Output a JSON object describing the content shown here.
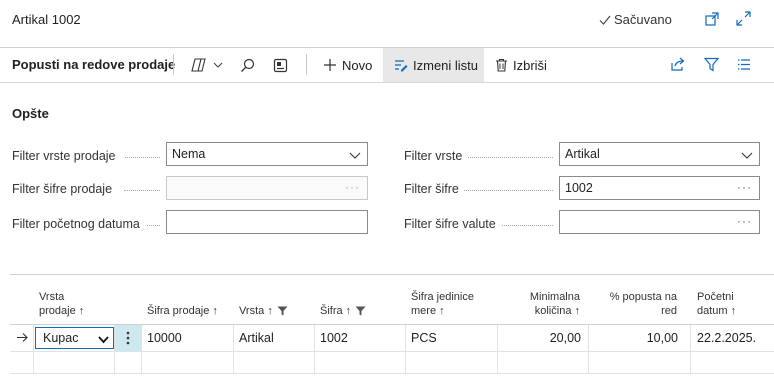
{
  "page": {
    "title": "Artikal 1002",
    "saved_label": "Sačuvano"
  },
  "toolbar": {
    "title": "Popusti na redove prodaje",
    "new_label": "Novo",
    "edit_list_label": "Izmeni listu",
    "delete_label": "Izbriši"
  },
  "section": {
    "title": "Opšte"
  },
  "filters": {
    "sales_type_label": "Filter vrste prodaje",
    "sales_type_value": "Nema",
    "sales_code_label": "Filter šifre prodaje",
    "start_date_label": "Filter početnog datuma",
    "type_label": "Filter vrste",
    "type_value": "Artikal",
    "code_label": "Filter šifre",
    "code_value": "1002",
    "currency_label": "Filter šifre valute"
  },
  "table": {
    "headers": {
      "sales_type_1": "Vrsta",
      "sales_type_2": "prodaje ↑",
      "sales_code": "Šifra prodaje ↑",
      "type": "Vrsta ↑",
      "code": "Šifra ↑",
      "uom_1": "Šifra jedinice",
      "uom_2": "mere ↑",
      "min_qty_1": "Minimalna",
      "min_qty_2": "količina ↑",
      "discount_1": "% popusta na",
      "discount_2": "red",
      "start_1": "Početni",
      "start_2": "datum ↑"
    },
    "rows": [
      {
        "sales_type": "Kupac",
        "sales_code": "10000",
        "type": "Artikal",
        "code": "1002",
        "uom": "PCS",
        "min_qty": "20,00",
        "discount": "10,00",
        "start_date": "22.2.2025."
      }
    ]
  },
  "colors": {
    "accent": "#0f6cbd",
    "selected_cell": "#cde8ef",
    "edit_list_bg": "#e8e8e8"
  },
  "icons": [
    "expand-out-icon",
    "fullscreen-icon",
    "copilot-icon",
    "search-icon",
    "personalize-icon",
    "plus-icon",
    "edit-list-icon",
    "trash-icon",
    "share-icon",
    "filter-icon",
    "list-view-icon",
    "chevron-down-icon",
    "ellipsis-icon",
    "row-arrow-icon",
    "funnel-icon"
  ]
}
